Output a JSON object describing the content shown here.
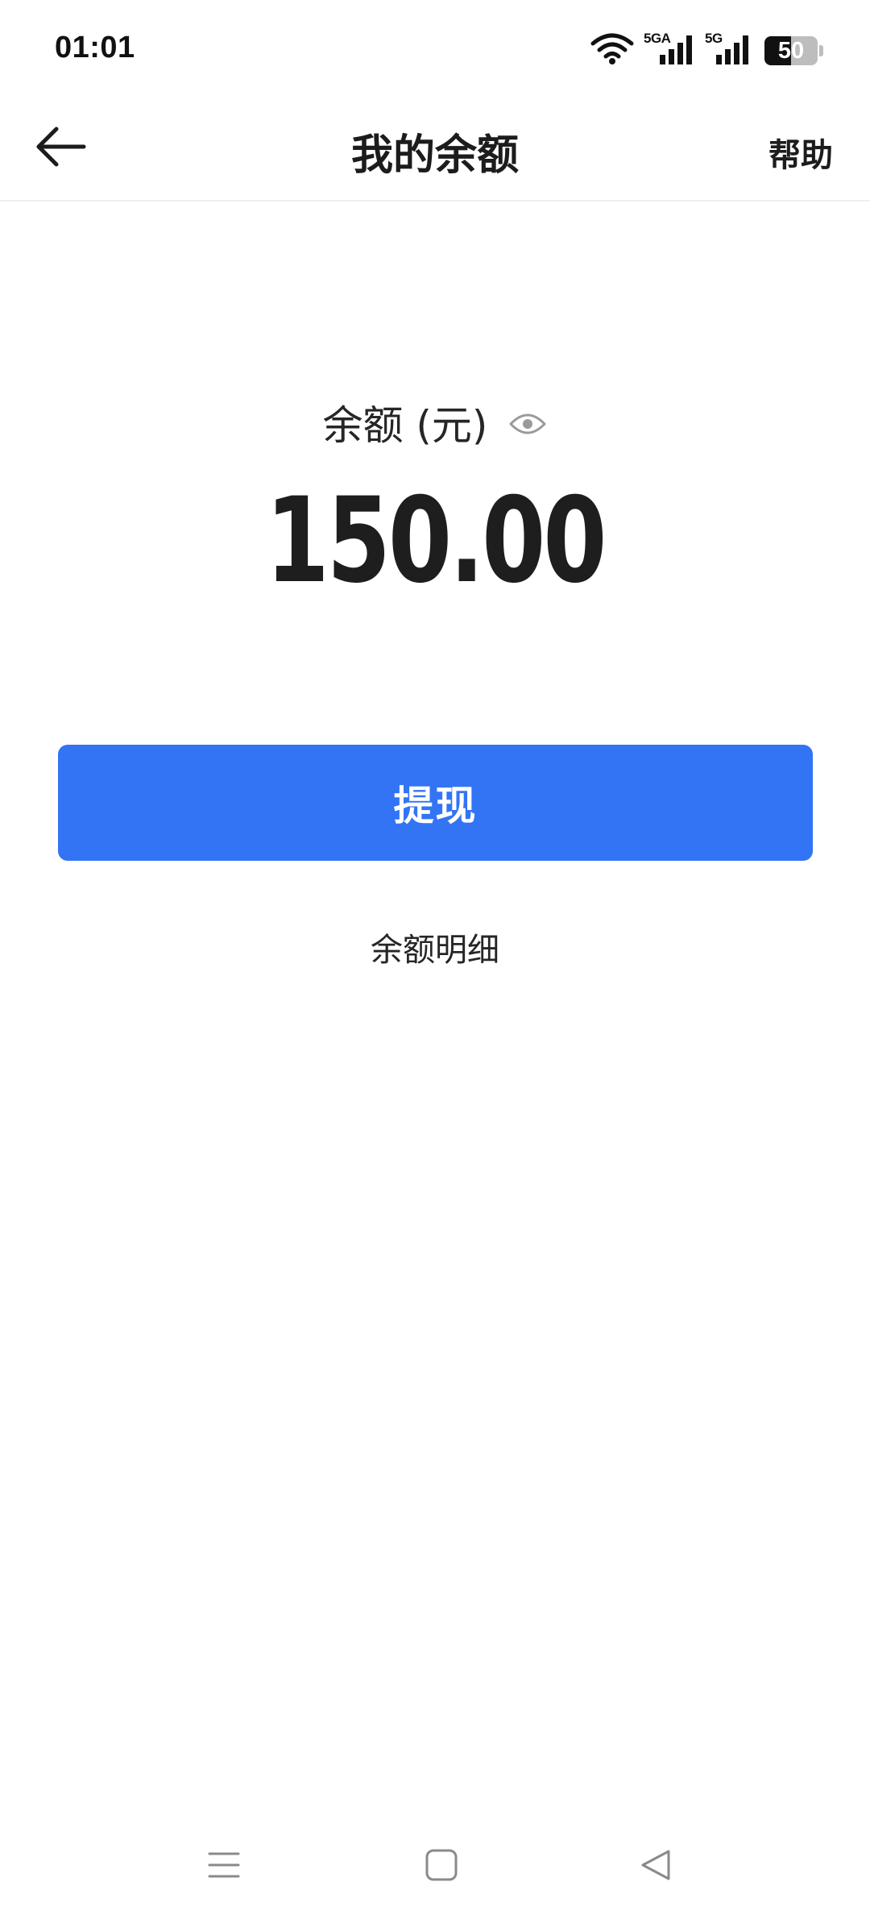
{
  "status_bar": {
    "time": "01:01",
    "network_1": "5GA",
    "network_2": "5G",
    "battery_level": "50",
    "battery_fraction": 0.5
  },
  "header": {
    "title": "我的余额",
    "help_label": "帮助"
  },
  "balance": {
    "label": "余额 (元)",
    "amount": "150.00"
  },
  "actions": {
    "withdraw_label": "提现",
    "details_label": "余额明细"
  },
  "colors": {
    "accent": "#3274f4",
    "text": "#222222"
  },
  "icons": {
    "back": "arrow-left-icon",
    "eye": "eye-icon",
    "wifi": "wifi-icon",
    "signal": "signal-icon",
    "battery": "battery-icon",
    "nav_menu": "menu-icon",
    "nav_home": "home-square-icon",
    "nav_back": "back-triangle-icon"
  }
}
